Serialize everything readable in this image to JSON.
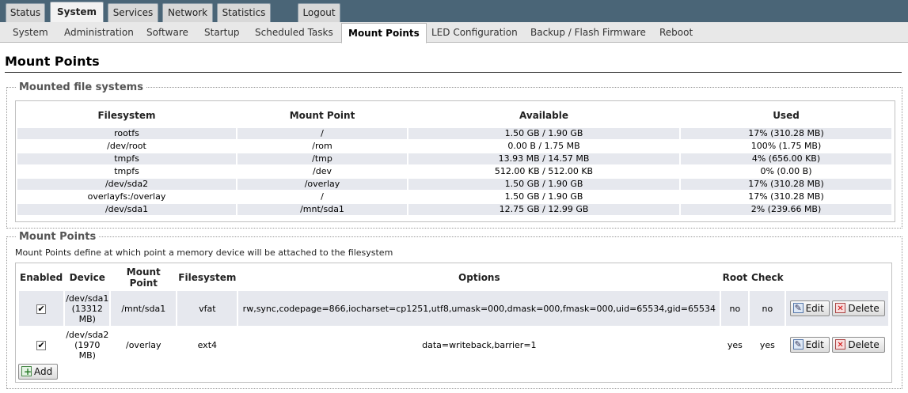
{
  "top_tabs": [
    "Status",
    "System",
    "Services",
    "Network",
    "Statistics",
    "Logout"
  ],
  "sub_tabs": [
    "System",
    "Administration",
    "Software",
    "Startup",
    "Scheduled Tasks",
    "Mount Points",
    "LED Configuration",
    "Backup / Flash Firmware",
    "Reboot"
  ],
  "page_title": "Mount Points",
  "mounted": {
    "legend": "Mounted file systems",
    "headers": [
      "Filesystem",
      "Mount Point",
      "Available",
      "Used"
    ],
    "rows": [
      [
        "rootfs",
        "/",
        "1.50 GB / 1.90 GB",
        "17% (310.28 MB)"
      ],
      [
        "/dev/root",
        "/rom",
        "0.00 B / 1.75 MB",
        "100% (1.75 MB)"
      ],
      [
        "tmpfs",
        "/tmp",
        "13.93 MB / 14.57 MB",
        "4% (656.00 KB)"
      ],
      [
        "tmpfs",
        "/dev",
        "512.00 KB / 512.00 KB",
        "0% (0.00 B)"
      ],
      [
        "/dev/sda2",
        "/overlay",
        "1.50 GB / 1.90 GB",
        "17% (310.28 MB)"
      ],
      [
        "overlayfs:/overlay",
        "/",
        "1.50 GB / 1.90 GB",
        "17% (310.28 MB)"
      ],
      [
        "/dev/sda1",
        "/mnt/sda1",
        "12.75 GB / 12.99 GB",
        "2% (239.66 MB)"
      ]
    ]
  },
  "mount_points": {
    "legend": "Mount Points",
    "description": "Mount Points define at which point a memory device will be attached to the filesystem",
    "headers": [
      "Enabled",
      "Device",
      "Mount Point",
      "Filesystem",
      "Options",
      "Root",
      "Check"
    ],
    "rows": [
      {
        "enabled": true,
        "device_line1": "/dev/sda1",
        "device_line2": "(13312",
        "device_line3": "MB)",
        "mount_point": "/mnt/sda1",
        "filesystem": "vfat",
        "options": "rw,sync,codepage=866,iocharset=cp1251,utf8,umask=000,dmask=000,fmask=000,uid=65534,gid=65534",
        "root": "no",
        "check": "no"
      },
      {
        "enabled": true,
        "device_line1": "/dev/sda2",
        "device_line2": "(1970",
        "device_line3": "MB)",
        "mount_point": "/overlay",
        "filesystem": "ext4",
        "options": "data=writeback,barrier=1",
        "root": "yes",
        "check": "yes"
      }
    ],
    "edit_label": "Edit",
    "delete_label": "Delete",
    "add_label": "Add"
  }
}
